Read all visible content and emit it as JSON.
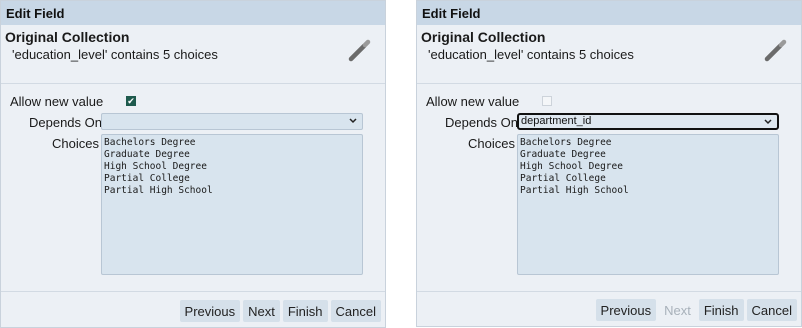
{
  "left": {
    "title": "Edit Field",
    "collection_title": "Original Collection",
    "collection_desc": "'education_level' contains 5 choices",
    "allow_label": "Allow new value",
    "allow_checked": true,
    "depends_label": "Depends On",
    "depends_value": "",
    "choices_label": "Choices",
    "choices": [
      "Bachelors Degree",
      "Graduate Degree",
      "High School Degree",
      "Partial College",
      "Partial High School"
    ],
    "buttons": {
      "previous": "Previous",
      "next": "Next",
      "finish": "Finish",
      "cancel": "Cancel"
    }
  },
  "right": {
    "title": "Edit Field",
    "collection_title": "Original Collection",
    "collection_desc": "'education_level' contains 5 choices",
    "allow_label": "Allow new value",
    "allow_checked": false,
    "depends_label": "Depends On",
    "depends_value": "department_id",
    "choices_label": "Choices",
    "choices": [
      "Bachelors Degree",
      "Graduate Degree",
      "High School Degree",
      "Partial College",
      "Partial High School"
    ],
    "buttons": {
      "previous": "Previous",
      "next": "Next",
      "finish": "Finish",
      "cancel": "Cancel"
    }
  },
  "colors": {
    "accent": "#1e5a4d",
    "titlebar": "#c8d7e6",
    "panel": "#ecf0f5"
  },
  "icons": {
    "edit": "magic-wand-icon",
    "dropdown": "chevron-down-icon"
  }
}
